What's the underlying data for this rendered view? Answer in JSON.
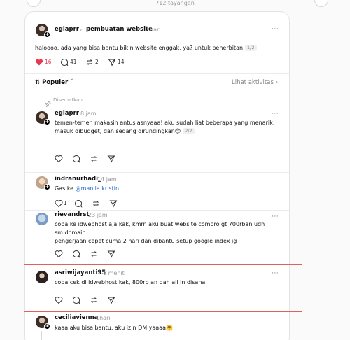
{
  "views_label": "712 tayangan",
  "main_post": {
    "username": "egiaprr",
    "topic": "pembuatan website",
    "time": "1hari",
    "text": "haloooo, ada yang bisa bantu bikin website enggak, ya? untuk penerbitan",
    "pager": "1/2",
    "likes": "16",
    "replies": "41",
    "reposts": "2",
    "shares": "14",
    "more": "···"
  },
  "sort": {
    "label": "Populer",
    "activity_link": "Lihat aktivitas"
  },
  "pinned_label": "Disematkan",
  "replies": [
    {
      "username": "egiaprr",
      "time": "8 jam",
      "text": "temen-temen makasih antusiasnyaaa! aku sudah liat beberapa yang menarik,\nmasuk dibudget, dan sedang dirundingkan😊",
      "pager": "2/2",
      "more": "···"
    },
    {
      "username": "indranurhadi_",
      "time": "14 jam",
      "text_prefix": "Gas ke ",
      "mention": "@manila.kristin",
      "like_count": "1"
    },
    {
      "username": "rievandrst",
      "time": "23 jam",
      "text": "coba ke idwebhost aja kak, kmrn aku buat website compro gt 700rban udh\nsm domain\npengerjaan cepet cuma 2 hari dan dibantu setup google index jg",
      "more": "···"
    },
    {
      "username": "asriwijayanti95",
      "time": "1 menit",
      "text": "coba cek di idwebhost kak, 800rb an dah all in disana",
      "more": "···"
    },
    {
      "username": "ceciliavienna",
      "time": "1hari",
      "text": "kaaa aku bisa bantu, aku izin DM yaaaa🤗"
    }
  ],
  "colors": {
    "like_red": "#e8384f",
    "mention_blue": "#2c6fcc",
    "highlight_border": "#e06060"
  }
}
